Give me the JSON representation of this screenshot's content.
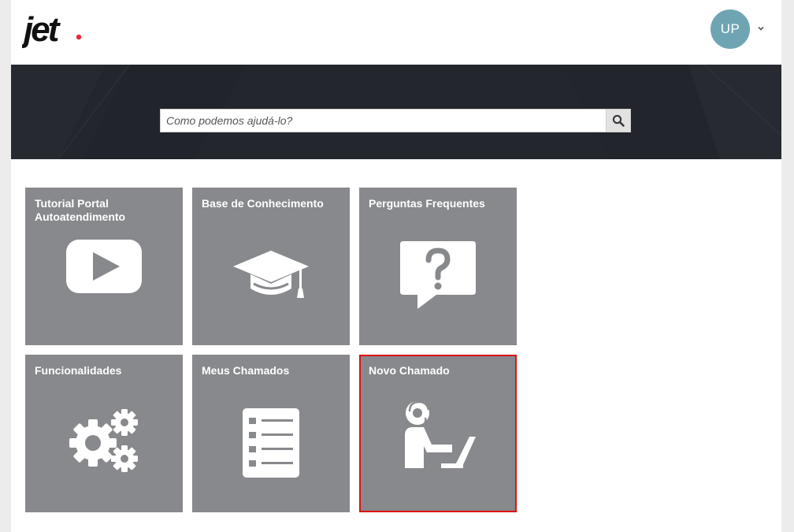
{
  "header": {
    "logo_text": "jet",
    "user_initials": "UP"
  },
  "search": {
    "placeholder": "Como podemos ajudá-lo?",
    "value": ""
  },
  "tiles": [
    {
      "title": "Tutorial Portal Autoatendimento",
      "icon": "play-video-icon"
    },
    {
      "title": "Base de Conhecimento",
      "icon": "graduation-cap-icon"
    },
    {
      "title": "Perguntas Frequentes",
      "icon": "question-bubble-icon"
    },
    {
      "title": "Funcionalidades",
      "icon": "gears-icon"
    },
    {
      "title": "Meus Chamados",
      "icon": "checklist-icon"
    },
    {
      "title": "Novo Chamado",
      "icon": "support-agent-laptop-icon",
      "selected": true
    }
  ],
  "colors": {
    "tile_bg": "#87898c",
    "hero_bg": "#23262c",
    "avatar_bg": "#6fa5b3",
    "logo_accent": "#e8273b",
    "selected_border": "#e01010"
  }
}
